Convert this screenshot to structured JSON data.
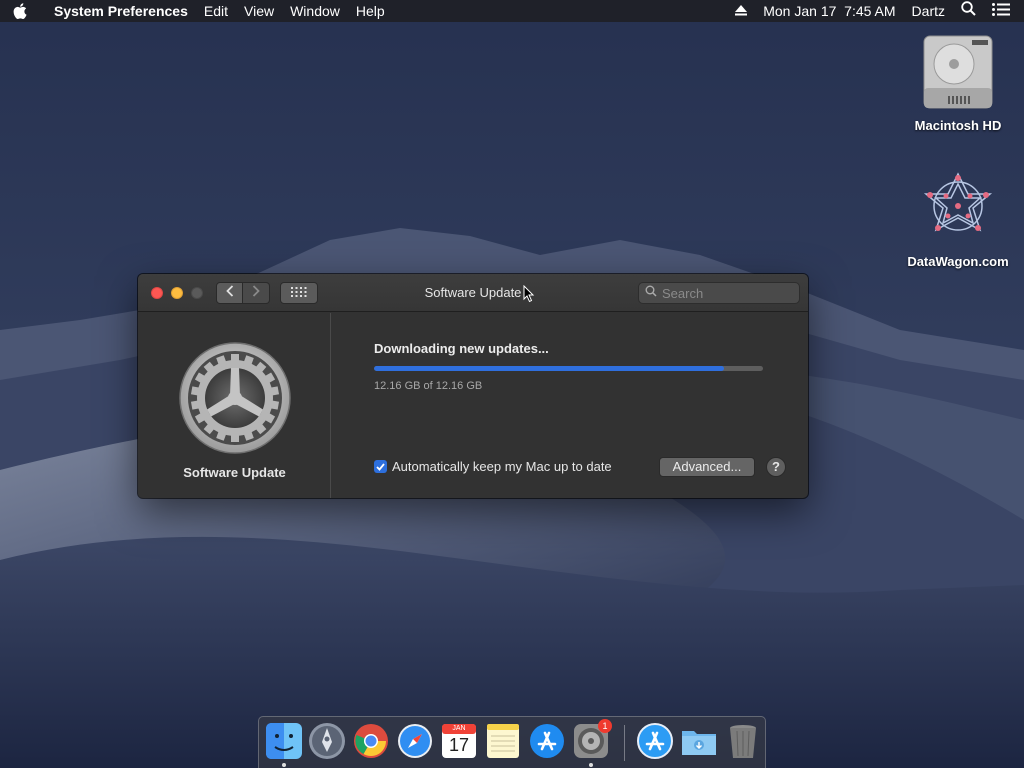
{
  "menubar": {
    "app_name": "System Preferences",
    "items": [
      "Edit",
      "View",
      "Window",
      "Help"
    ],
    "clock": "Mon Jan 17  7:45 AM",
    "user": "Dartz",
    "icons": [
      "apple-icon",
      "eject-icon",
      "spotlight-search-icon",
      "notification-center-icon"
    ]
  },
  "desktop": {
    "icons": [
      {
        "label": "Macintosh HD",
        "icon": "hard-drive-icon"
      },
      {
        "label": "DataWagon.com",
        "icon": "datawagon-logo-icon"
      }
    ]
  },
  "window": {
    "title": "Software Update",
    "search_placeholder": "Search",
    "sidebar_label": "Software Update",
    "status": "Downloading new updates...",
    "progress_fraction": 0.9,
    "progress_text": "12.16 GB of 12.16 GB",
    "auto_update_label": "Automatically keep my Mac up to date",
    "auto_update_checked": true,
    "advanced_button": "Advanced...",
    "help_button": "?"
  },
  "dock": {
    "items": [
      {
        "name": "finder",
        "running": true
      },
      {
        "name": "launchpad",
        "running": false
      },
      {
        "name": "chrome",
        "running": false
      },
      {
        "name": "safari",
        "running": false
      },
      {
        "name": "calendar",
        "running": false,
        "month": "JAN",
        "day": "17"
      },
      {
        "name": "notes",
        "running": false
      },
      {
        "name": "app-store",
        "running": false
      },
      {
        "name": "system-preferences",
        "running": true,
        "badge": "1"
      },
      {
        "name": "app-store-2",
        "running": false
      },
      {
        "name": "downloads-folder",
        "running": false
      },
      {
        "name": "trash",
        "running": false
      }
    ]
  },
  "colors": {
    "accent": "#2f6fde",
    "close": "#fc5753",
    "minimize": "#fdbc40",
    "window_bg": "#323232"
  }
}
